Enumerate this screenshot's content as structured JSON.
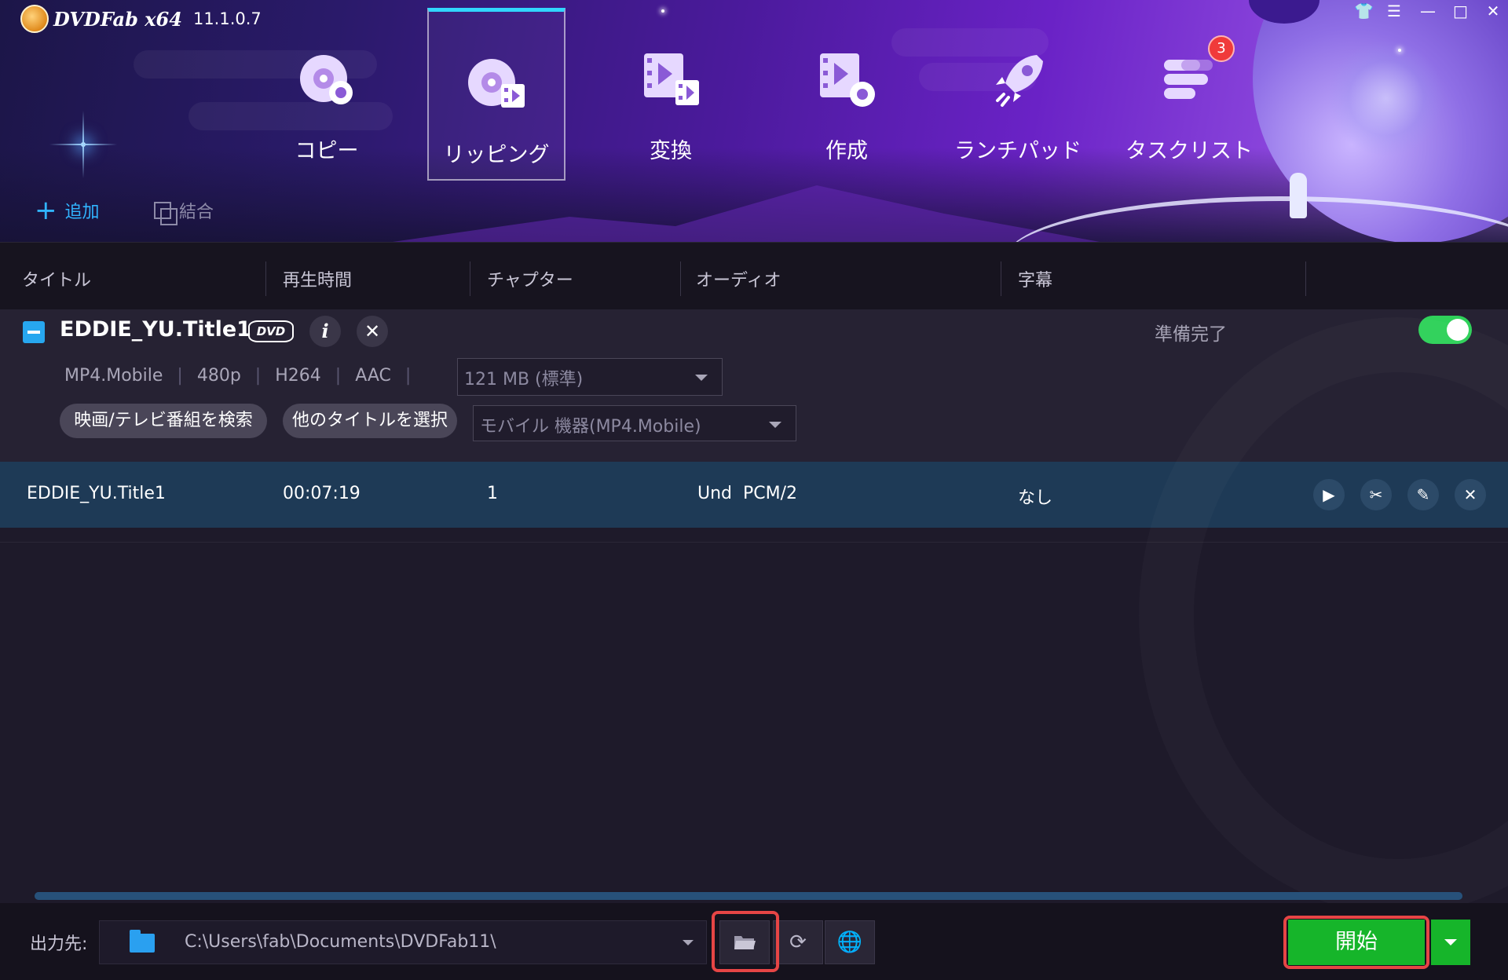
{
  "app": {
    "name": "DVDFab x64",
    "version": "11.1.0.7"
  },
  "window_controls": [
    "skin-icon",
    "menu-icon",
    "minimize-icon",
    "maximize-icon",
    "close-icon"
  ],
  "nav": {
    "items": [
      {
        "label": "コピー",
        "icon": "copy-disc-icon",
        "active": false
      },
      {
        "label": "リッピング",
        "icon": "ripper-disc-icon",
        "active": true
      },
      {
        "label": "変換",
        "icon": "converter-film-icon",
        "active": false
      },
      {
        "label": "作成",
        "icon": "creator-film-icon",
        "active": false
      },
      {
        "label": "ランチパッド",
        "icon": "launchpad-rocket-icon",
        "active": false
      },
      {
        "label": "タスクリスト",
        "icon": "task-list-icon",
        "active": false,
        "badge": "3"
      }
    ]
  },
  "toolbar": {
    "add_label": "追加",
    "merge_label": "結合"
  },
  "columns": [
    "タイトル",
    "再生時間",
    "チャプター",
    "オーディオ",
    "字幕"
  ],
  "title_panel": {
    "title": "EDDIE_YU.Title1",
    "disc_badge": "DVD",
    "status": "準備完了",
    "enabled": true,
    "specs": [
      "MP4.Mobile",
      "480p",
      "H264",
      "AAC"
    ],
    "size_select": "121 MB (標準)",
    "search_button": "映画/テレビ番組を検索",
    "other_title_button": "他のタイトルを選択",
    "profile_select": "モバイル 機器(MP4.Mobile)"
  },
  "row": {
    "title": "EDDIE_YU.Title1",
    "duration": "00:07:19",
    "chapters": "1",
    "audio": "Und  PCM/2",
    "subtitle": "なし"
  },
  "footer": {
    "output_label": "出力先:",
    "output_path": "C:\\Users\\fab\\Documents\\DVDFab11\\",
    "start_label": "開始"
  },
  "colors": {
    "accent_blue": "#27a7ef",
    "start_green": "#16b52a",
    "toggle_green": "#2fd15a",
    "highlight_red": "#e64545",
    "selected_row": "#1e3a56"
  }
}
